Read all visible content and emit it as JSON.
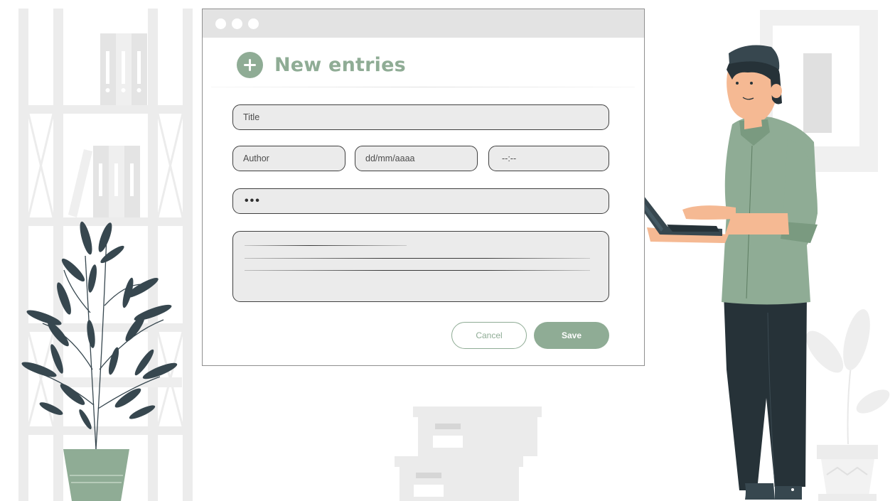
{
  "form": {
    "title": "New entries",
    "icon": "plus-icon",
    "fields": {
      "title_placeholder": "Title",
      "author_placeholder": "Author",
      "date_placeholder": "dd/mm/aaaa",
      "time_placeholder": "--:--",
      "password_mask": "•••"
    },
    "buttons": {
      "cancel": "Cancel",
      "save": "Save"
    }
  },
  "colors": {
    "accent": "#8fac95",
    "leaf": "#37474f",
    "shirt": "#8fac95",
    "pants": "#263238",
    "background_gray": "#ebebeb"
  }
}
